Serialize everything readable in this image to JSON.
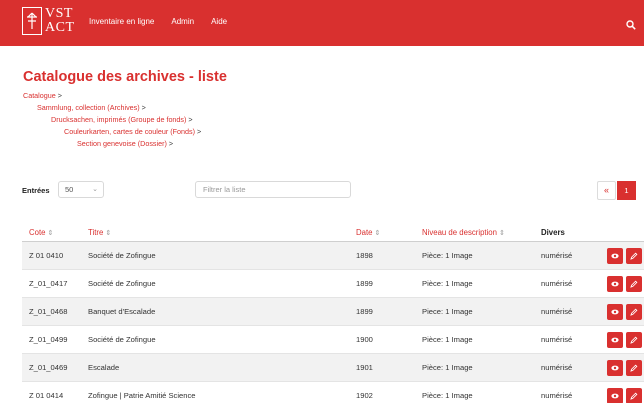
{
  "header": {
    "logo_line1": "VST",
    "logo_line2": "ACT",
    "nav": [
      "Inventaire en ligne",
      "Admin",
      "Aide"
    ]
  },
  "page": {
    "title": "Catalogue des archives - liste"
  },
  "breadcrumb": [
    {
      "label": "Catalogue",
      "sep": ">"
    },
    {
      "label": "Sammlung, collection (Archives)",
      "sep": ">"
    },
    {
      "label": "Drucksachen, imprimés (Groupe de fonds)",
      "sep": ">"
    },
    {
      "label": "Couleurkarten, cartes de couleur (Fonds)",
      "sep": ">"
    },
    {
      "label": "Section genevoise (Dossier)",
      "sep": ">"
    }
  ],
  "controls": {
    "entries_label": "Entrées",
    "entries_value": "50",
    "filter_placeholder": "Filtrer la liste"
  },
  "pagination": {
    "prev": "«",
    "current": "1"
  },
  "table": {
    "headers": {
      "cote": "Cote",
      "titre": "Titre",
      "date": "Date",
      "niveau": "Niveau de description",
      "divers": "Divers"
    },
    "rows": [
      {
        "cote": "Z 01 0410",
        "titre": "Société de Zofingue",
        "date": "1898",
        "niveau": "Pièce: 1 Image",
        "divers": "numérisé"
      },
      {
        "cote": "Z_01_0417",
        "titre": "Société de Zofingue",
        "date": "1899",
        "niveau": "Pièce: 1 Image",
        "divers": "numérisé"
      },
      {
        "cote": "Z_01_0468",
        "titre": "Banquet d'Escalade",
        "date": "1899",
        "niveau": "Piece: 1 Image",
        "divers": "numérisé"
      },
      {
        "cote": "Z_01_0499",
        "titre": "Société de Zofingue",
        "date": "1900",
        "niveau": "Pièce: 1 Image",
        "divers": "numérisé"
      },
      {
        "cote": "Z_01_0469",
        "titre": "Escalade",
        "date": "1901",
        "niveau": "Pièce: 1 Image",
        "divers": "numérisé"
      },
      {
        "cote": "Z 01 0414",
        "titre": "Zofingue | Patrie Amitié Science",
        "date": "1902",
        "niveau": "Pièce: 1 Image",
        "divers": "numérisé"
      }
    ]
  },
  "colors": {
    "brand": "#d9302f",
    "stripe": "#f2f2f2"
  },
  "icons": {
    "search": "search-icon",
    "view": "eye-icon",
    "edit": "pencil-icon",
    "sort": "sort-icon",
    "caret": "chevron-down-icon"
  }
}
